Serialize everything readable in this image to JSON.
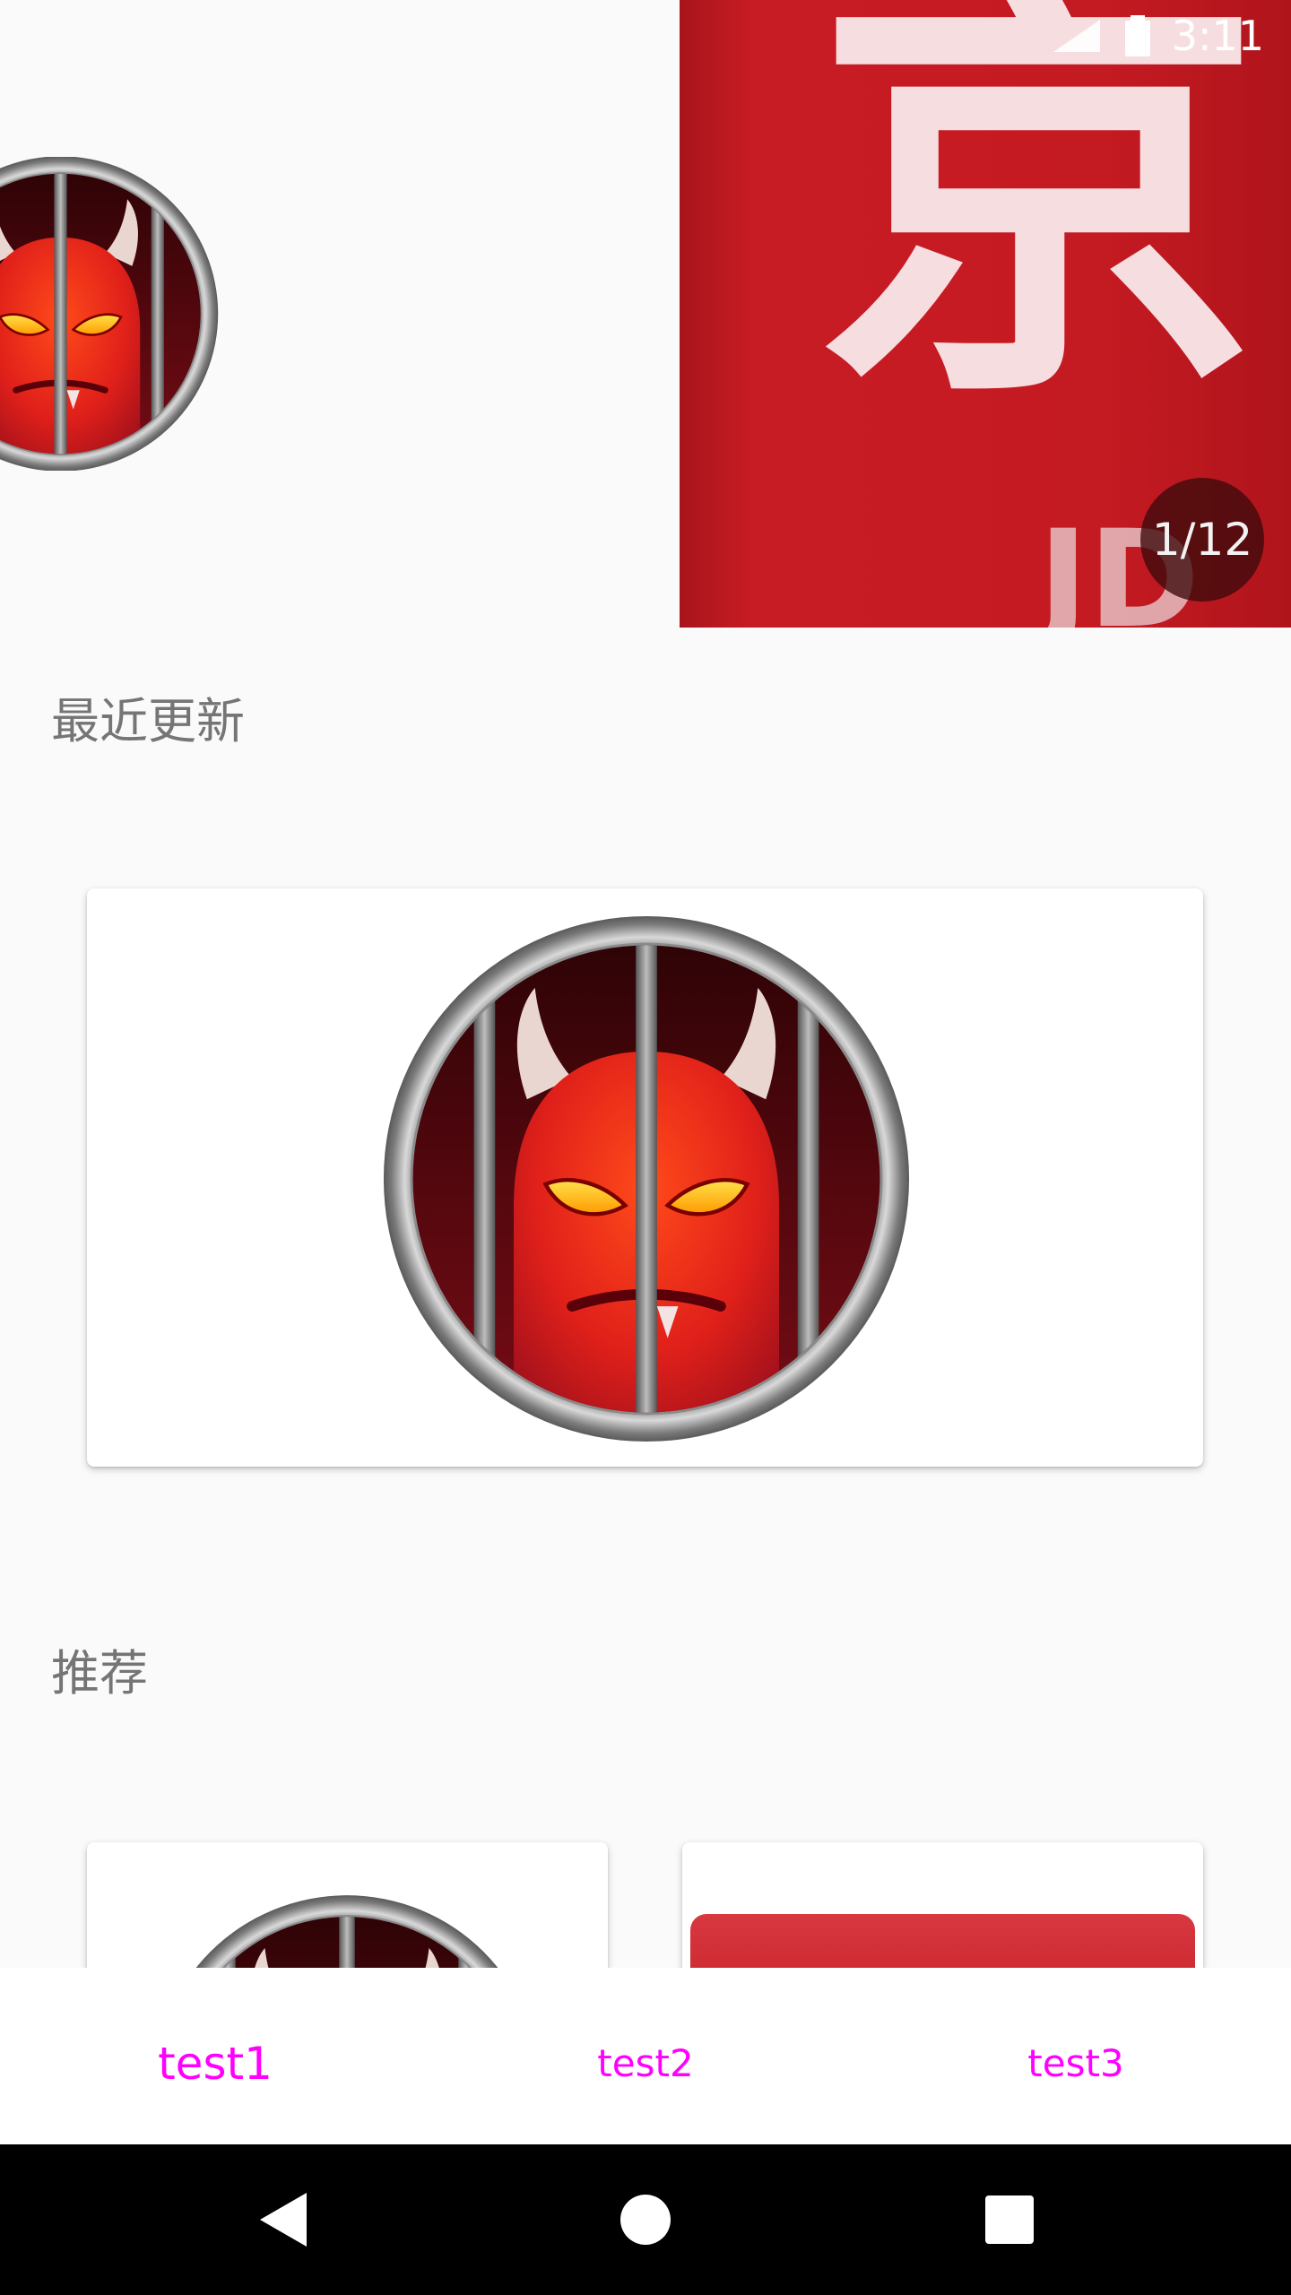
{
  "status_bar": {
    "time": "3:11"
  },
  "banner": {
    "glyph": "京",
    "sub_text": "JD",
    "counter": "1/12"
  },
  "sections": {
    "recent_title": "最近更新",
    "recommend_title": "推荐"
  },
  "bottom_nav": {
    "items": [
      {
        "label": "test1",
        "selected": true
      },
      {
        "label": "test2",
        "selected": false
      },
      {
        "label": "test3",
        "selected": false
      }
    ],
    "color": "#ff00ff"
  },
  "colors": {
    "background": "#fafafa",
    "banner_red": "#c41a22",
    "nav_text": "#ff00ff",
    "section_title": "#757575"
  },
  "icons": {
    "card_image": "devil-jail-icon",
    "back": "back-triangle-icon",
    "home": "home-circle-icon",
    "recents": "recents-square-icon"
  }
}
